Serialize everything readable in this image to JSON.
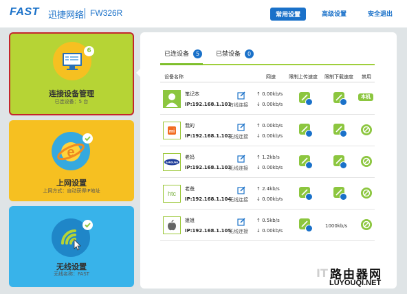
{
  "header": {
    "logo": "FAST",
    "brand_cn": "迅捷网络",
    "model": "FW326R",
    "nav": [
      "常用设置",
      "高级设置",
      "安全退出"
    ]
  },
  "cards": [
    {
      "title": "连接设备管理",
      "sub": "已连设备：5 台",
      "badge": "6",
      "icon": "monitor-icon"
    },
    {
      "title": "上网设置",
      "sub": "上网方式：自动获得IP地址",
      "badge_icon": "check-icon",
      "icon": "ie-globe-icon"
    },
    {
      "title": "无线设置",
      "sub": "无线名称：FAST",
      "badge_icon": "check-icon",
      "icon": "wifi-icon"
    }
  ],
  "tabs": [
    {
      "label": "已连设备",
      "count": "5"
    },
    {
      "label": "已禁设备",
      "count": "0"
    }
  ],
  "columns": [
    "设备名称",
    "网速",
    "限制上传速度",
    "限制下载速度",
    "禁用"
  ],
  "devices": [
    {
      "name": "笔记本",
      "ip": "IP:192.168.1.101",
      "conn": "有线连接",
      "up": "↑ 0.00kb/s",
      "down": "↓ 0.00kb/s",
      "down_limit": "",
      "ban": "本机",
      "icon": "user-icon"
    },
    {
      "name": "我的",
      "ip": "IP:192.168.1.102",
      "conn": "无线连接",
      "up": "↑ 0.00kb/s",
      "down": "↓ 0.00kb/s",
      "down_limit": "",
      "ban": "",
      "icon": "mi-logo-icon"
    },
    {
      "name": "老妈",
      "ip": "IP:192.168.1.103",
      "conn": "无线连接",
      "up": "↑ 1.2kb/s",
      "down": "↓ 0.00kb/s",
      "down_limit": "",
      "ban": "",
      "icon": "samsung-logo-icon"
    },
    {
      "name": "老爸",
      "ip": "IP:192.168.1.104",
      "conn": "无线连接",
      "up": "↑ 2.4kb/s",
      "down": "↓ 0.00kb/s",
      "down_limit": "",
      "ban": "",
      "icon": "htc-logo-icon"
    },
    {
      "name": "姐姐",
      "ip": "IP:192.168.1.105",
      "conn": "无线连接",
      "up": "↑ 0.5kb/s",
      "down": "↓ 0.00kb/s",
      "down_limit": "1000kb/s",
      "ban": "",
      "icon": "apple-logo-icon"
    }
  ],
  "watermark": {
    "cn": "路由器网",
    "url": "LUYOUQI.NET",
    "it": "IT"
  },
  "colors": {
    "accent": "#1a71c9",
    "green": "#8cc63f",
    "card1": "#b6d435",
    "card2": "#f6c021",
    "card3": "#38b3ea",
    "selected_border": "#c4262c"
  }
}
